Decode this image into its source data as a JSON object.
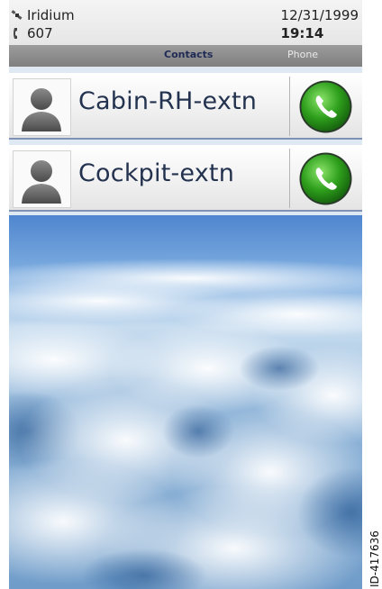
{
  "status": {
    "carrier": "Iridium",
    "extension": "607",
    "date": "12/31/1999",
    "time": "19:14",
    "carrier_icon": "satellite-icon",
    "phone_icon": "handset-icon"
  },
  "tabs": [
    {
      "label": "Contacts",
      "active": true
    },
    {
      "label": "Phone",
      "active": false
    }
  ],
  "contacts": [
    {
      "name": "Cabin-RH-extn",
      "avatar_icon": "person-icon",
      "call_icon": "phone-call-icon"
    },
    {
      "name": "Cockpit-extn",
      "avatar_icon": "person-icon",
      "call_icon": "phone-call-icon"
    }
  ],
  "figure_id": "ID-417636",
  "colors": {
    "tab_active": "#1f2a55",
    "contact_text": "#23324f",
    "call_green": "#2e9f1c",
    "divider_blue": "#7f91b4"
  }
}
